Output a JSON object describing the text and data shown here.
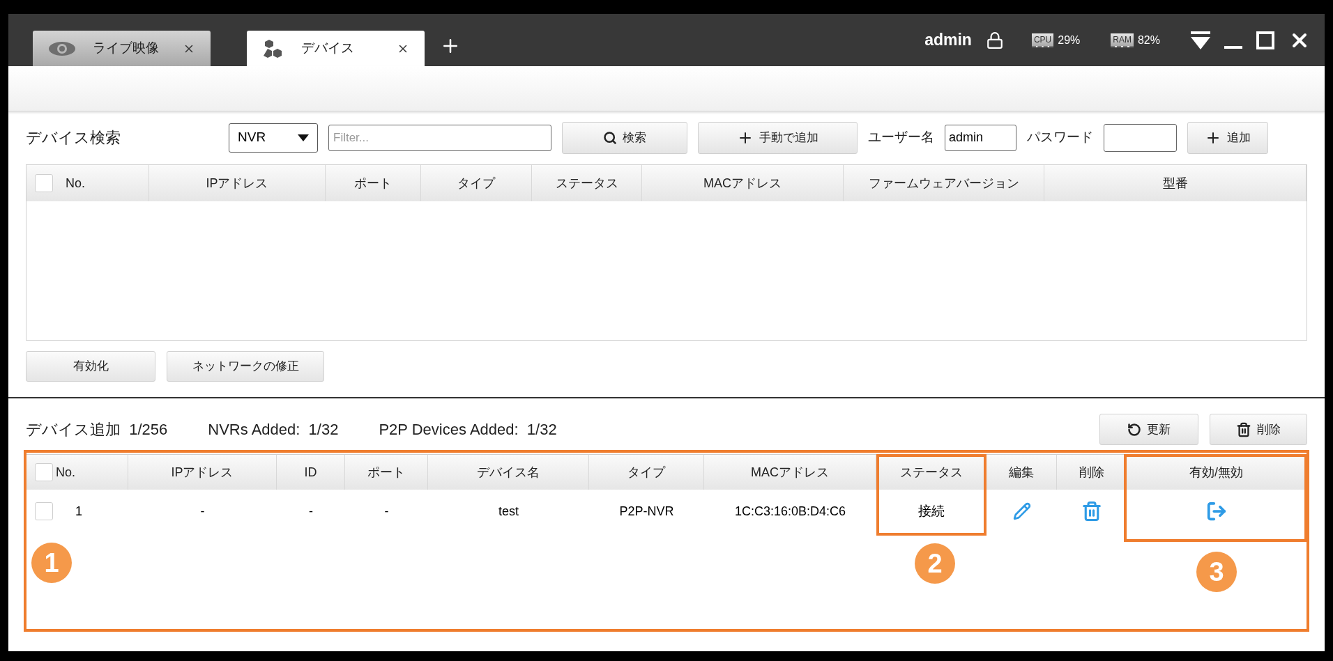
{
  "window": {
    "tabs": [
      {
        "kind": "live",
        "label": "ライブ映像",
        "selected": false
      },
      {
        "kind": "devices",
        "label": "デバイス",
        "selected": true
      }
    ],
    "user": "admin",
    "meters": [
      {
        "chip": "CPU",
        "value": "29%"
      },
      {
        "chip": "RAM",
        "value": "82%"
      }
    ]
  },
  "search": {
    "title": "デバイス検索",
    "device_type": "NVR",
    "filter_placeholder": "Filter...",
    "search_button": "検索",
    "manual_add_button": "手動で追加",
    "username_label": "ユーザー名",
    "username": "admin",
    "password_label": "パスワード",
    "add_button": "追加",
    "header_checked": false,
    "columns": [
      "No.",
      "IPアドレス",
      "ポート",
      "タイプ",
      "ステータス",
      "MACアドレス",
      "ファームウェアバージョン",
      "型番"
    ],
    "buttons": [
      "有効化",
      "ネットワークの修正"
    ]
  },
  "added": {
    "counts": [
      {
        "label": "デバイス追加",
        "value": "1/256"
      },
      {
        "label": "NVRs Added:",
        "value": "1/32"
      },
      {
        "label": "P2P Devices Added:",
        "value": "1/32"
      }
    ],
    "refresh_button": "更新",
    "delete_button": "削除",
    "header_checked": false,
    "columns": [
      "No.",
      "IPアドレス",
      "ID",
      "ポート",
      "デバイス名",
      "タイプ",
      "MACアドレス",
      "ステータス",
      "編集",
      "削除",
      "有効/無効"
    ],
    "rows": [
      {
        "checked": false,
        "no": "1",
        "ip": "-",
        "id": "-",
        "port": "-",
        "name": "test",
        "type": "P2P-NVR",
        "mac": "1C:C3:16:0B:D4:C6",
        "status": "接続"
      }
    ]
  },
  "annotations": [
    {
      "kind": "table",
      "number": "1"
    },
    {
      "kind": "status",
      "number": "2"
    },
    {
      "kind": "toggle",
      "number": "3"
    }
  ]
}
